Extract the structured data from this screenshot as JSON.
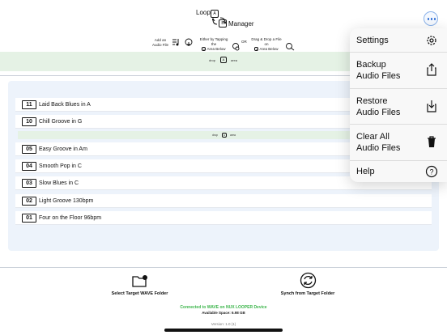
{
  "header": {
    "title_loop": "Loop",
    "title_manager": "Manager",
    "title_box_a": "A",
    "title_box_b": "B",
    "hint_add": "Add an\nAudio File",
    "hint_tap": "Either by Tapping\nthe",
    "hint_tap_box": "A",
    "hint_tap_tail": "Area Below",
    "hint_or": "OR",
    "hint_drag": "Drag & Drop a File\non",
    "hint_drag_box": "A",
    "hint_drag_tail": "Area Below"
  },
  "drop_zone_top": {
    "left": "drop",
    "box": "A",
    "right": "area"
  },
  "drop_zone_mid": {
    "left": "drop",
    "box": "A",
    "right": "area"
  },
  "tracks_upper": [
    {
      "num": "11",
      "name": "Laid Back Blues in A"
    },
    {
      "num": "10",
      "name": "Chill Groove in G"
    }
  ],
  "tracks_lower": [
    {
      "num": "05",
      "name": "Easy Groove in Am"
    },
    {
      "num": "04",
      "name": "Smooth Pop in C"
    },
    {
      "num": "03",
      "name": "Slow Blues in C"
    },
    {
      "num": "02",
      "name": "Light Groove 130bpm"
    },
    {
      "num": "01",
      "name": "Four on the Floor 96bpm"
    }
  ],
  "bottom": {
    "select_folder_label": "Select Target WAVE Folder",
    "synch_label": "Synch from Target Folder",
    "status_connected": "Connected to WAVE on NUX LOOPER Device",
    "status_space": "Available Space: 6.98 GB",
    "version": "Version: 1.0 (1)"
  },
  "menu": {
    "items": [
      {
        "label": "Settings",
        "icon": "gear-icon"
      },
      {
        "label": "Backup\nAudio Files",
        "icon": "share-up-icon"
      },
      {
        "label": "Restore\nAudio Files",
        "icon": "download-in-icon"
      },
      {
        "label": "Clear All\nAudio Files",
        "icon": "trash-icon"
      },
      {
        "label": "Help",
        "icon": "question-icon"
      }
    ]
  },
  "colors": {
    "accent": "#2f6fd6",
    "drop_zone": "#e5f2e5",
    "list_panel": "#edf3fb",
    "status_green": "#3bb54a"
  }
}
